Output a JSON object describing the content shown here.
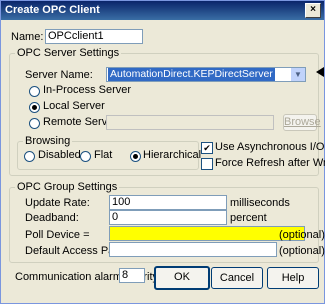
{
  "window": {
    "title": "Create OPC Client",
    "close_glyph": "×"
  },
  "name": {
    "label": "Name:",
    "value": "OPCclient1"
  },
  "server_settings": {
    "group_label": "OPC Server Settings",
    "server_name_label": "Server Name:",
    "server_name_value": "AutomationDirect.KEPDirectServer",
    "modes": [
      {
        "label": "In-Process Server",
        "selected": false
      },
      {
        "label": "Local Server",
        "selected": true
      },
      {
        "label": "Remote Server",
        "selected": false
      }
    ],
    "remote_value": "",
    "browse_label": "Browse",
    "browsing": {
      "group_label": "Browsing",
      "options": [
        {
          "label": "Disabled",
          "selected": false
        },
        {
          "label": "Flat",
          "selected": false
        },
        {
          "label": "Hierarchical",
          "selected": true
        }
      ]
    },
    "use_async_label": "Use Asynchronous I/O",
    "use_async_checked": true,
    "force_refresh_label": "Force Refresh after Write",
    "force_refresh_checked": false
  },
  "group_settings": {
    "group_label": "OPC Group Settings",
    "update_rate_label": "Update Rate:",
    "update_rate_value": "100",
    "update_rate_unit": "milliseconds",
    "deadband_label": "Deadband:",
    "deadband_value": "0",
    "deadband_unit": "percent",
    "poll_device_label": "Poll Device =",
    "poll_device_value": "",
    "poll_device_hint": "(optional)",
    "default_path_label": "Default Access Path:",
    "default_path_value": "",
    "default_path_hint": "(optional)"
  },
  "comm_alarm": {
    "label": "Communication alarm priority:",
    "value": "8"
  },
  "buttons": {
    "ok": "OK",
    "cancel": "Cancel",
    "help": "Help"
  },
  "colors": {
    "titlebar": "#0a246a",
    "poll_device_bg": "#ffff00",
    "selection": "#316ac5"
  }
}
